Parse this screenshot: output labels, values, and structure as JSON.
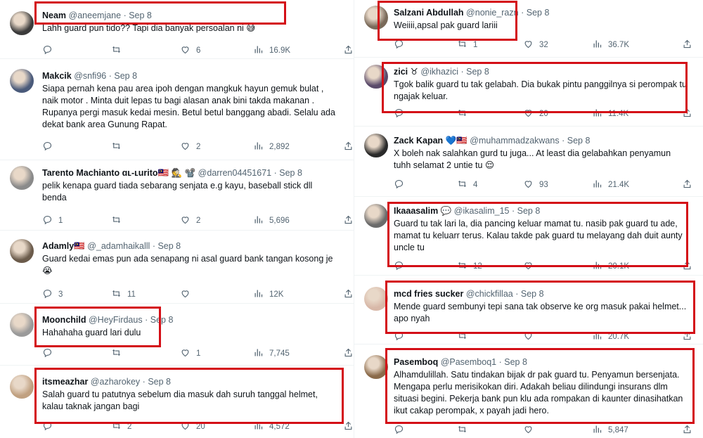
{
  "accent": "#d40f17",
  "left": [
    {
      "name": "Neam",
      "handle": "@aneemjane",
      "dot": "·",
      "date": "Sep 8",
      "lines": [
        "Lahh guard pun tido?? Tapi dia banyak persoalan ni 😅"
      ],
      "replies": "",
      "retweets": "",
      "likes": "6",
      "views": "16.9K",
      "avatar": "#3b3b3b"
    },
    {
      "name": "Makcik",
      "handle": "@snfi96",
      "dot": "·",
      "date": "Sep 8",
      "lines": [
        "Siapa pernah kena pau area ipoh dengan mangkuk hayun gemuk bulat ,",
        "naik motor . Minta duit lepas tu bagi alasan anak bini takda makanan .",
        "Rupanya pergi masuk kedai mesin. Betul betul banggang abadi. Selalu ada",
        "dekat bank area Gunung Rapat."
      ],
      "replies": "",
      "retweets": "",
      "likes": "2",
      "views": "2,892",
      "avatar": "#4a5a7a"
    },
    {
      "name": "Tarento Machianto ɑʟ-ʟurito🇲🇾 🕵️ 📽️",
      "handle": "@darren04451671",
      "dot": "·",
      "date": "Sep 8",
      "lines": [
        "pelik kenapa guard tiada sebarang senjata e.g kayu, baseball stick dll",
        "benda"
      ],
      "replies": "1",
      "retweets": "",
      "likes": "2",
      "views": "5,696",
      "avatar": "#8a8a8a"
    },
    {
      "name": "Adamly🇲🇾",
      "handle": "@_adamhaikalll",
      "dot": "·",
      "date": "Sep 8",
      "lines": [
        "Guard kedai emas pun ada senapang ni asal guard bank tangan kosong je",
        "😭"
      ],
      "replies": "3",
      "retweets": "11",
      "likes": "",
      "views": "12K",
      "avatar": "#6b5b4b"
    },
    {
      "name": "Moonchild",
      "handle": "@HeyFirdaus",
      "dot": "·",
      "date": "Sep 8",
      "lines": [
        "Hahahaha guard lari dulu"
      ],
      "replies": "",
      "retweets": "",
      "likes": "1",
      "views": "7,745",
      "avatar": "#9a9a9a"
    },
    {
      "name": "itsmeazhar",
      "handle": "@azharokey",
      "dot": "·",
      "date": "Sep 8",
      "lines": [
        "Salah guard tu patutnya sebelum dia masuk dah suruh tanggal helmet,",
        "kalau taknak jangan bagi"
      ],
      "replies": "",
      "retweets": "2",
      "likes": "20",
      "views": "4,572",
      "avatar": "#c0a080"
    }
  ],
  "right": [
    {
      "name": "Salzani Abdullah",
      "handle": "@nonie_razn",
      "dot": "·",
      "date": "Sep 8",
      "lines": [
        "Weiiii,apsal pak guard lariii"
      ],
      "replies": "",
      "retweets": "1",
      "likes": "32",
      "views": "36.7K",
      "avatar": "#7a6a5a"
    },
    {
      "name": "zici ♉",
      "handle": "@ikhazici",
      "dot": "·",
      "date": "Sep 8",
      "lines": [
        "Tgok balik guard tu tak gelabah. Dia bukak pintu panggilnya si perompak tu",
        "ngajak keluar."
      ],
      "replies": "",
      "retweets": "",
      "likes": "20",
      "views": "11.4K",
      "avatar": "#5a4a6a"
    },
    {
      "name": "Zack Kapan 💙🇲🇾",
      "handle": "@muhammadzakwans",
      "dot": "·",
      "date": "Sep 8",
      "lines": [
        "X boleh nak salahkan gurd tu juga... At least dia gelabahkan penyamun",
        "tuhh selamat 2 untie tu 😌"
      ],
      "replies": "",
      "retweets": "4",
      "likes": "93",
      "views": "21.4K",
      "avatar": "#2a2a2a"
    },
    {
      "name": "Ikaaasalim 💬",
      "handle": "@ikasalim_15",
      "dot": "·",
      "date": "Sep 8",
      "lines": [
        "Guard tu tak lari la, dia pancing keluar mamat tu. nasib pak guard tu ade,",
        "mamat tu keluarr terus. Kalau takde pak guard tu melayang dah duit aunty",
        "uncle tu"
      ],
      "replies": "",
      "retweets": "12",
      "likes": "",
      "views": "20.1K",
      "avatar": "#6a6a6a"
    },
    {
      "name": "mcd fries sucker",
      "handle": "@chickfillaa",
      "dot": "·",
      "date": "Sep 8",
      "lines": [
        "Mende guard sembunyi tepi sana tak observe ke org masuk pakai helmet...",
        "apo nyah"
      ],
      "replies": "",
      "retweets": "",
      "likes": "",
      "views": "20.7K",
      "avatar": "#d8b8a8"
    },
    {
      "name": "Pasemboq",
      "handle": "@Pasemboq1",
      "dot": "·",
      "date": "Sep 8",
      "lines": [
        "Alhamdulillah. Satu tindakan bijak dr pak guard tu. Penyamun bersenjata.",
        "Mengapa perlu merisikokan diri. Adakah beliau dilindungi insurans dlm",
        "situasi begini. Pekerja bank pun klu ada rompakan di kaunter dinasihatkan",
        "ikut cakap perompak, x payah jadi hero."
      ],
      "replies": "",
      "retweets": "",
      "likes": "",
      "views": "5,847",
      "avatar": "#8a6a4a"
    }
  ]
}
